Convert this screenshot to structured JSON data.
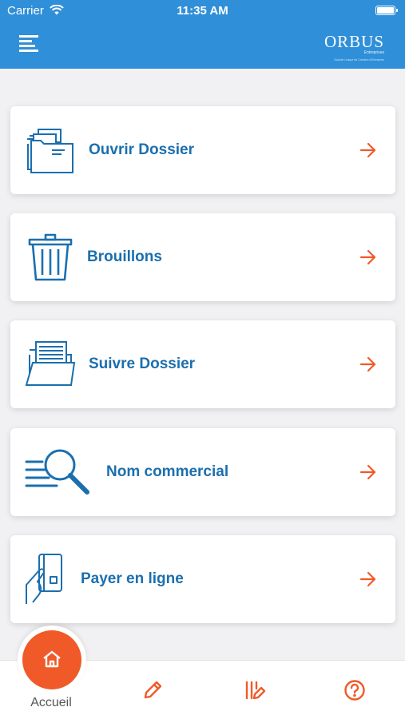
{
  "status_bar": {
    "carrier": "Carrier",
    "time": "11:35 AM"
  },
  "header": {
    "menu_icon": "hamburger-menu-icon",
    "logo": {
      "name": "ORBUS",
      "subtitle": "Entreprises",
      "tagline": "Guichet Unique de Création d'Entreprise"
    }
  },
  "menu": [
    {
      "label": "Ouvrir Dossier",
      "icon": "open-folder-icon"
    },
    {
      "label": "Brouillons",
      "icon": "trash-icon"
    },
    {
      "label": "Suivre Dossier",
      "icon": "document-folder-icon"
    },
    {
      "label": "Nom commercial",
      "icon": "search-magnifier-icon"
    },
    {
      "label": "Payer en ligne",
      "icon": "card-payment-icon"
    }
  ],
  "tabbar": {
    "home_label": "Accueil",
    "items": [
      "home-icon",
      "pencil-icon",
      "edit-list-icon",
      "help-icon"
    ]
  },
  "colors": {
    "header": "#2f8fd8",
    "label": "#1b6fae",
    "accent": "#f05a28",
    "background": "#f1f1f3"
  }
}
